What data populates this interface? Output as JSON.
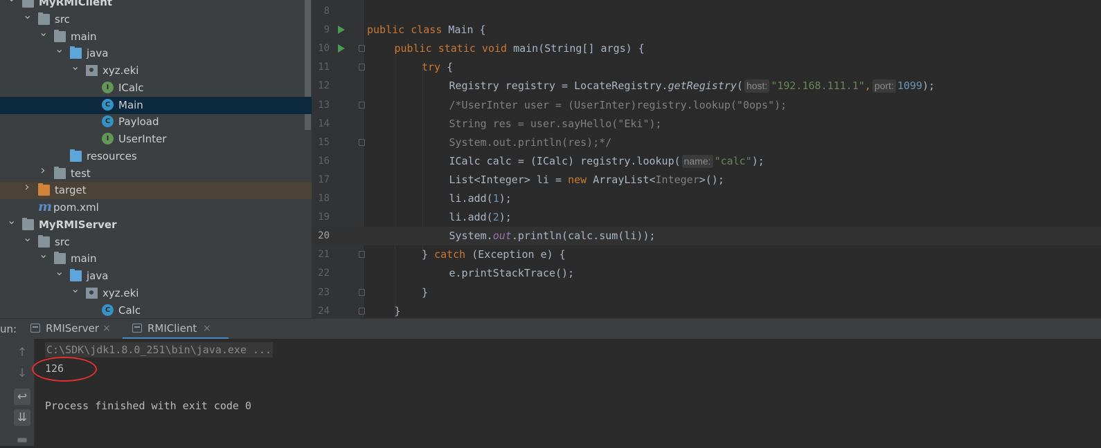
{
  "project_tree": {
    "items": [
      {
        "label": "MyRMIClient",
        "kind": "module",
        "expanded": true
      },
      {
        "label": "src",
        "kind": "folder",
        "expanded": true
      },
      {
        "label": "main",
        "kind": "folder",
        "expanded": true
      },
      {
        "label": "java",
        "kind": "source-folder",
        "expanded": true
      },
      {
        "label": "xyz.eki",
        "kind": "package",
        "expanded": true
      },
      {
        "label": "ICalc",
        "kind": "interface",
        "badge": "I"
      },
      {
        "label": "Main",
        "kind": "class",
        "badge": "C",
        "selected": true
      },
      {
        "label": "Payload",
        "kind": "class",
        "badge": "C"
      },
      {
        "label": "UserInter",
        "kind": "interface",
        "badge": "I"
      },
      {
        "label": "resources",
        "kind": "resources-folder"
      },
      {
        "label": "test",
        "kind": "folder",
        "expanded": false
      },
      {
        "label": "target",
        "kind": "excluded-folder",
        "expanded": false
      },
      {
        "label": "pom.xml",
        "kind": "maven",
        "badge": "m"
      },
      {
        "label": "MyRMIServer",
        "kind": "module",
        "expanded": true
      },
      {
        "label": "src",
        "kind": "folder",
        "expanded": true
      },
      {
        "label": "main",
        "kind": "folder",
        "expanded": true
      },
      {
        "label": "java",
        "kind": "source-folder",
        "expanded": true
      },
      {
        "label": "xyz.eki",
        "kind": "package",
        "expanded": true
      },
      {
        "label": "Calc",
        "kind": "class",
        "badge": "C"
      }
    ]
  },
  "editor": {
    "current_line": "20",
    "lines": [
      {
        "n": "8"
      },
      {
        "n": "9",
        "kw1": "public class",
        "t1": " Main {"
      },
      {
        "n": "10",
        "kw1": "public static void",
        "t1": " main(String[] args) {"
      },
      {
        "n": "11",
        "kw1": "try",
        "t1": " {"
      },
      {
        "n": "12",
        "t1": "Registry registry = LocateRegistry.",
        "it1": "getRegistry",
        "t2": "(",
        "hint1": "host:",
        "s1": "\"192.168.111.1\"",
        "p1": ",",
        "hint2": "port:",
        "num1": "1099",
        "t3": ");"
      },
      {
        "n": "13",
        "c1": "/*UserInter user = (UserInter)registry.lookup(\"0ops\");"
      },
      {
        "n": "14",
        "c1": "String res = user.sayHello(\"Eki\");"
      },
      {
        "n": "15",
        "c1": "System.out.println(res);*/"
      },
      {
        "n": "16",
        "t1": "ICalc calc = (ICalc) registry.lookup(",
        "hint1": "name:",
        "s1": "\"calc\"",
        "t2": ");"
      },
      {
        "n": "17",
        "t1": "List<Integer> li = ",
        "kw1": "new",
        "t2": " ArrayList<",
        "tp1": "Integer",
        "t3": ">();"
      },
      {
        "n": "18",
        "t1": "li.add(",
        "num1": "1",
        "t2": ");"
      },
      {
        "n": "19",
        "t1": "li.add(",
        "num1": "2",
        "t2": ");"
      },
      {
        "n": "20",
        "t1": "System.",
        "f1": "out",
        "t2": ".println(calc.sum(li));"
      },
      {
        "n": "21",
        "t1": "} ",
        "kw1": "catch",
        "t2": " (Exception e) {"
      },
      {
        "n": "22",
        "t1": "e.printStackTrace();"
      },
      {
        "n": "23",
        "t1": "}"
      },
      {
        "n": "24",
        "t1": "}"
      }
    ]
  },
  "run_panel": {
    "label": "un:",
    "tabs": [
      {
        "label": "RMIServer",
        "close": "×",
        "active": false
      },
      {
        "label": "RMIClient",
        "close": "×",
        "active": true
      }
    ],
    "output": {
      "command": "C:\\SDK\\jdk1.8.0_251\\bin\\java.exe ...",
      "result": "126",
      "exit_message": "Process finished with exit code 0"
    },
    "toolbar_icons": [
      "up-arrow-icon",
      "down-arrow-icon",
      "soft-wrap-icon",
      "scroll-to-end-icon",
      "print-icon"
    ]
  },
  "colors": {
    "keyword": "#cc7832",
    "string": "#6a8759",
    "number": "#6897bb",
    "comment": "#808080",
    "annotation_circle": "#e53030"
  }
}
